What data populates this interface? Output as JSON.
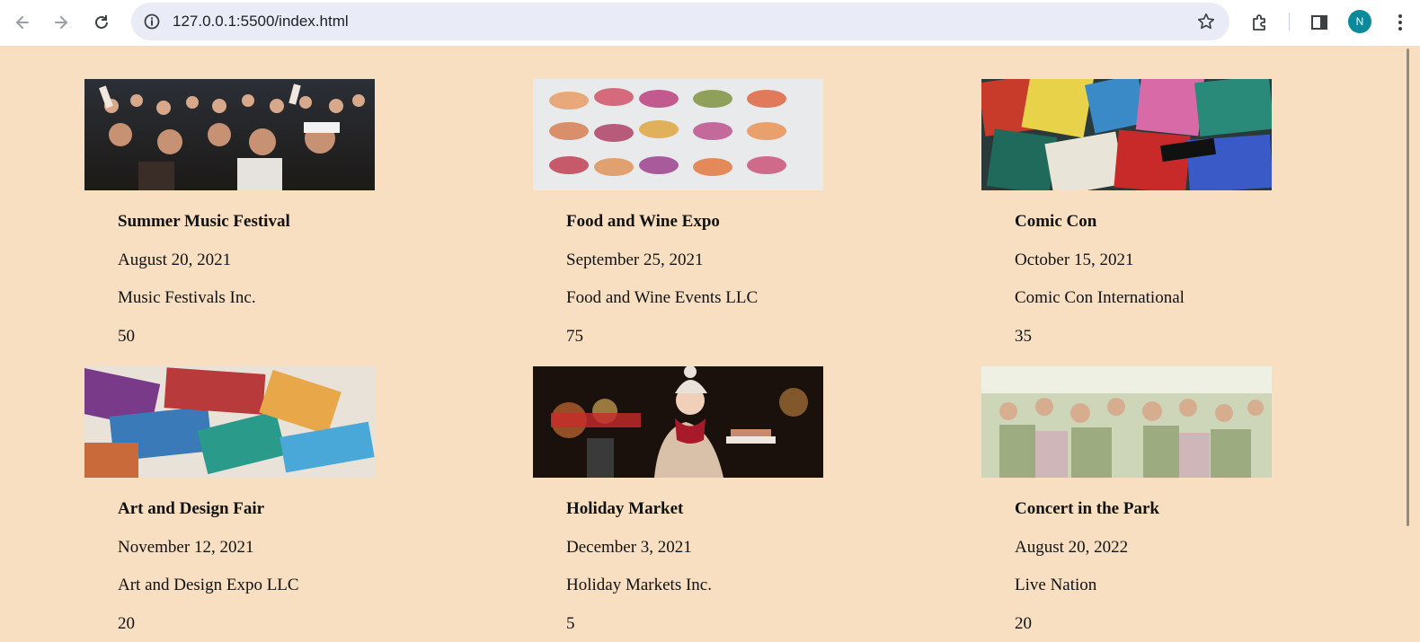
{
  "browser": {
    "url": "127.0.0.1:5500/index.html",
    "profile_initial": "N"
  },
  "events": [
    {
      "title": "Summer Music Festival",
      "date": "August 20, 2021",
      "organizer": "Music Festivals Inc.",
      "count": "50",
      "image": "crowd-cheering-concert-photo"
    },
    {
      "title": "Food and Wine Expo",
      "date": "September 25, 2021",
      "organizer": "Food and Wine Events LLC",
      "count": "75",
      "image": "canapes-on-platter-photo"
    },
    {
      "title": "Comic Con",
      "date": "October 15, 2021",
      "organizer": "Comic Con International",
      "count": "35",
      "image": "comic-books-pile-photo"
    },
    {
      "title": "Art and Design Fair",
      "date": "November 12, 2021",
      "organizer": "Art and Design Expo LLC",
      "count": "20",
      "image": "colorful-paint-brushes-photo"
    },
    {
      "title": "Holiday Market",
      "date": "December 3, 2021",
      "organizer": "Holiday Markets Inc.",
      "count": "5",
      "image": "woman-holding-treats-night-market-photo"
    },
    {
      "title": "Concert in the Park",
      "date": "August 20, 2022",
      "organizer": "Live Nation",
      "count": "20",
      "image": "outdoor-festival-crowd-photo"
    }
  ],
  "colors": {
    "page_background": "#f8dfc1",
    "avatar": "#0b8a9c",
    "omnibox": "#e9ecf6"
  }
}
